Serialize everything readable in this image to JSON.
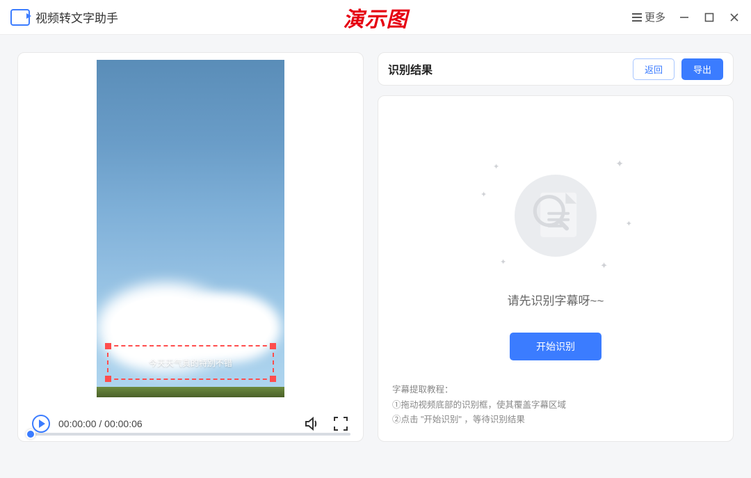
{
  "titlebar": {
    "app_title": "视频转文字助手",
    "overlay_text": "演示图",
    "more_label": "更多"
  },
  "video": {
    "subtitle_sample": "今天天气真的特别不错",
    "current_time": "00:00:00",
    "total_time": "00:00:06",
    "time_display": "00:00:00 / 00:00:06"
  },
  "result": {
    "header_title": "识别结果",
    "back_label": "返回",
    "export_label": "导出",
    "empty_text": "请先识别字幕呀~~",
    "start_button": "开始识别",
    "tutorial_title": "字幕提取教程：",
    "tutorial_step1": "①拖动视频底部的识别框，使其覆盖字幕区域",
    "tutorial_step2": "②点击 \"开始识别\" ，等待识别结果"
  }
}
